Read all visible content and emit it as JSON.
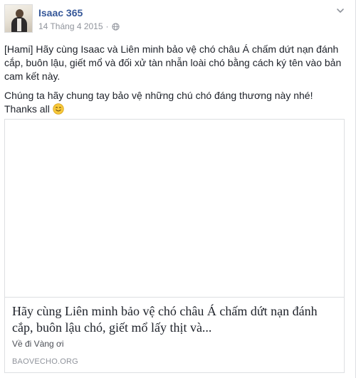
{
  "post": {
    "author": "Isaac 365",
    "date": "14 Tháng 4 2015",
    "separator": "·",
    "paragraph1": "[Hami] Hãy cùng Isaac và Liên minh bảo vệ chó châu Á chấm dứt nạn đánh cắp, buôn lậu, giết mổ và đối xử tàn nhẫn loài chó bằng cách ký tên vào bản cam kết này.",
    "paragraph2": "Chúng ta hãy chung tay bảo vệ những chú chó đáng thương này nhé! Thanks all"
  },
  "icons": {
    "privacy": "globe-icon",
    "menu": "chevron-down-icon",
    "emoji": "smiling-face-emoji"
  },
  "link_card": {
    "title": "Hãy cùng Liên minh bảo vệ chó châu Á chấm dứt nạn đánh cắp, buôn lậu chó, giết mổ lấy thịt và...",
    "description": "Về đi Vàng ơi",
    "domain": "BAOVECHO.ORG"
  },
  "colors": {
    "link": "#365899",
    "meta": "#90949c",
    "text": "#1d2129",
    "border": "#dddfe2"
  }
}
